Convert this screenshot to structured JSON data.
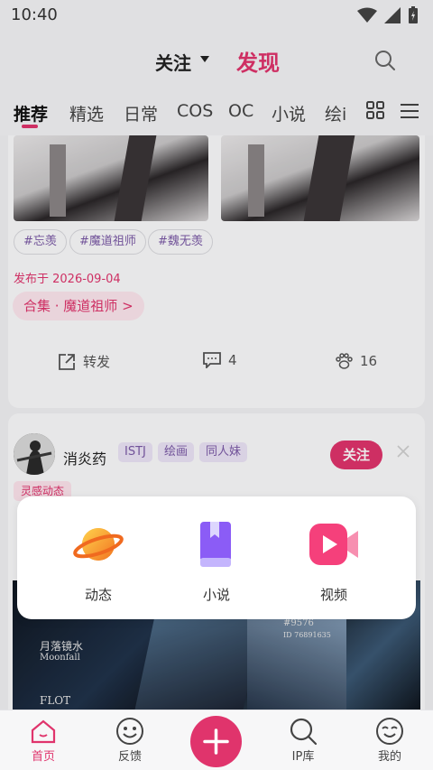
{
  "status_bar": {
    "time": "10:40"
  },
  "header": {
    "follow_label": "关注",
    "discover_label": "发现"
  },
  "tabs": [
    "推荐",
    "精选",
    "日常",
    "COS",
    "OC",
    "小说",
    "绘i"
  ],
  "post1": {
    "tags": [
      "#忘羡",
      "#魔道祖师",
      "#魏无羡"
    ],
    "published": "发布于 2026-09-04",
    "collection": "合集 · 魔道祖师 >",
    "share_label": "转发",
    "comments": "4",
    "likes": "16"
  },
  "post2": {
    "username": "消炎药",
    "badges": [
      "ISTJ",
      "绘画",
      "同人妹"
    ],
    "follow_label": "关注",
    "category": "灵感动态",
    "poster_text": [
      "月落镜水",
      "Moonfall",
      "FLOT",
      "#9576",
      "ID 76891635"
    ]
  },
  "popup": {
    "items": [
      {
        "label": "动态",
        "icon": "planet-icon"
      },
      {
        "label": "小说",
        "icon": "book-icon"
      },
      {
        "label": "视频",
        "icon": "video-icon"
      }
    ]
  },
  "bottom_nav": [
    {
      "label": "首页",
      "icon": "home-icon"
    },
    {
      "label": "反馈",
      "icon": "feedback-smiley-icon"
    },
    {
      "label": "IP库",
      "icon": "search-icon"
    },
    {
      "label": "我的",
      "icon": "profile-smiley-icon"
    }
  ],
  "colors": {
    "accent": "#e0346c",
    "tag_purple": "#7b5aa6"
  }
}
